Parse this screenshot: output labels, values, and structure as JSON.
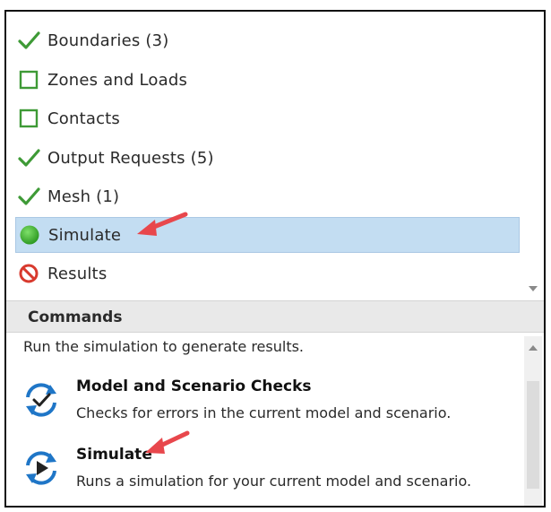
{
  "workflow": {
    "items": [
      {
        "label": "Boundaries (3)",
        "icon": "check-icon",
        "status": "complete"
      },
      {
        "label": "Zones and Loads",
        "icon": "empty-square-icon",
        "status": "incomplete"
      },
      {
        "label": "Contacts",
        "icon": "empty-square-icon",
        "status": "incomplete"
      },
      {
        "label": "Output Requests (5)",
        "icon": "check-icon",
        "status": "complete"
      },
      {
        "label": "Mesh (1)",
        "icon": "check-icon",
        "status": "complete"
      },
      {
        "label": "Simulate",
        "icon": "green-circle-icon",
        "status": "current"
      },
      {
        "label": "Results",
        "icon": "no-entry-icon",
        "status": "blocked"
      }
    ]
  },
  "commands": {
    "header": "Commands",
    "description": "Run the simulation to generate results.",
    "items": [
      {
        "title": "Model and Scenario Checks",
        "text": "Checks for errors in the current model and scenario.",
        "icon": "refresh-check-icon"
      },
      {
        "title": "Simulate",
        "text": "Runs a simulation for your current model and scenario.",
        "icon": "refresh-play-icon"
      }
    ]
  },
  "colors": {
    "check_green": "#3e9a36",
    "selected_bg": "#c3ddf2",
    "annotation_red": "#e8474c",
    "no_entry_red": "#d83a2e"
  }
}
